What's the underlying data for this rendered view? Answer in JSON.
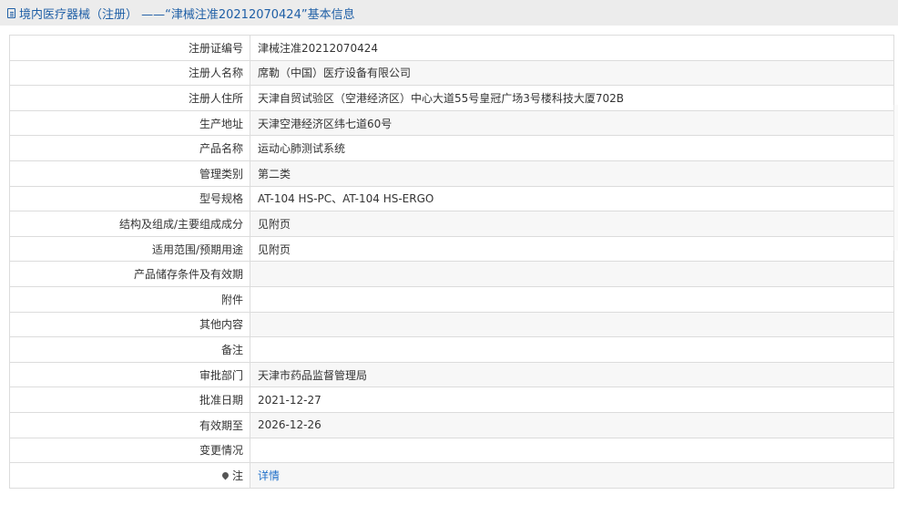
{
  "header": {
    "title": "境内医疗器械（注册） ——“津械注准20212070424”基本信息"
  },
  "rows": [
    {
      "label": "注册证编号",
      "value": "津械注准20212070424"
    },
    {
      "label": "注册人名称",
      "value": "席勒（中国）医疗设备有限公司"
    },
    {
      "label": "注册人住所",
      "value": "天津自贸试验区（空港经济区）中心大道55号皇冠广场3号楼科技大厦702B"
    },
    {
      "label": "生产地址",
      "value": "天津空港经济区纬七道60号"
    },
    {
      "label": "产品名称",
      "value": "运动心肺测试系统"
    },
    {
      "label": "管理类别",
      "value": "第二类"
    },
    {
      "label": "型号规格",
      "value": "AT-104 HS-PC、AT-104 HS-ERGO"
    },
    {
      "label": "结构及组成/主要组成成分",
      "value": "见附页"
    },
    {
      "label": "适用范围/预期用途",
      "value": "见附页"
    },
    {
      "label": "产品储存条件及有效期",
      "value": ""
    },
    {
      "label": "附件",
      "value": ""
    },
    {
      "label": "其他内容",
      "value": ""
    },
    {
      "label": "备注",
      "value": ""
    },
    {
      "label": "审批部门",
      "value": "天津市药品监督管理局"
    },
    {
      "label": "批准日期",
      "value": "2021-12-27"
    },
    {
      "label": "有效期至",
      "value": "2026-12-26"
    },
    {
      "label": "变更情况",
      "value": ""
    },
    {
      "label": "注",
      "value": "详情"
    }
  ],
  "colors": {
    "header_bg": "#ececec",
    "header_text": "#1f5fa6",
    "link": "#1f6fc9",
    "border": "#dcdcdc",
    "shaded_row": "#f7f7f7"
  }
}
